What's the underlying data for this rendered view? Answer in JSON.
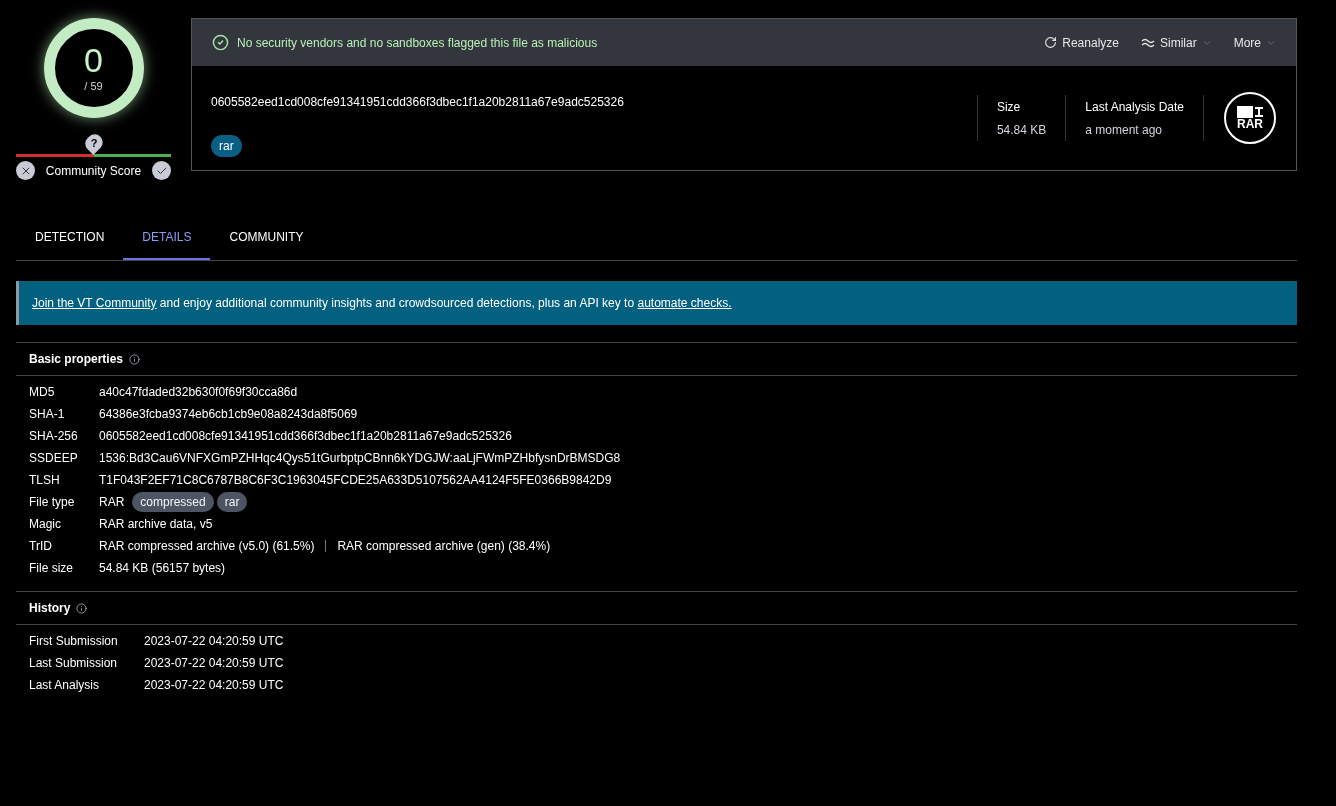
{
  "score": {
    "detections": "0",
    "total": "/ 59"
  },
  "community": {
    "marker": "?",
    "label": "Community Score"
  },
  "banner": {
    "status": "No security vendors and no sandboxes flagged this file as malicious",
    "actions": [
      {
        "label": "Reanalyze",
        "kind": "refresh"
      },
      {
        "label": "Similar",
        "kind": "similar"
      },
      {
        "label": "More",
        "kind": "more"
      }
    ]
  },
  "file": {
    "hash": "0605582eed1cd008cfe91341951cdd366f3dbec1f1a20b2811a67e9adc525326",
    "tags": [
      "rar"
    ],
    "stats": [
      {
        "label": "Size",
        "value": "54.84 KB"
      },
      {
        "label": "Last Analysis Date",
        "value": "a moment ago"
      }
    ],
    "type_icon": "RAR"
  },
  "tabs": [
    {
      "label": "DETECTION",
      "selected": false
    },
    {
      "label": "DETAILS",
      "selected": true
    },
    {
      "label": "COMMUNITY",
      "selected": false
    }
  ],
  "notice": [
    {
      "kind": "link",
      "text": "Join the VT Community"
    },
    {
      "kind": "text",
      "text": " and enjoy additional community insights and crowdsourced detections, plus an API key to "
    },
    {
      "kind": "link",
      "text": "automate checks."
    }
  ],
  "basic_properties": {
    "title": "Basic properties",
    "rows": [
      {
        "label": "MD5",
        "values": [
          "a40c47fdaded32b630f0f69f30cca86d"
        ]
      },
      {
        "label": "SHA-1",
        "values": [
          "64386e3fcba9374eb6cb1cb9e08a8243da8f5069"
        ]
      },
      {
        "label": "SHA-256",
        "values": [
          "0605582eed1cd008cfe91341951cdd366f3dbec1f1a20b2811a67e9adc525326"
        ]
      },
      {
        "label": "SSDEEP",
        "values": [
          "1536:Bd3Cau6VNFXGmPZHHqc4Qys51tGurbptpCBnn6kYDGJW:aaLjFWmPZHbfysnDrBMSDG8"
        ]
      },
      {
        "label": "TLSH",
        "values": [
          "T1F043F2EF71C8C6787B8C6F3C1963045FCDE25A633D5107562AA4124F5FE0366B9842D9"
        ]
      },
      {
        "label": "File type",
        "values": [
          "RAR"
        ],
        "tags": [
          "compressed",
          "rar"
        ]
      },
      {
        "label": "Magic",
        "values": [
          "RAR archive data, v5"
        ]
      },
      {
        "label": "TrID",
        "values": [
          "RAR compressed archive (v5.0) (61.5%)",
          "RAR compressed archive (gen) (38.4%)"
        ]
      },
      {
        "label": "File size",
        "values": [
          "54.84 KB (56157 bytes)"
        ]
      }
    ]
  },
  "history": {
    "title": "History",
    "rows": [
      {
        "label": "First Submission",
        "value": "2023-07-22 04:20:59 UTC"
      },
      {
        "label": "Last Submission",
        "value": "2023-07-22 04:20:59 UTC"
      },
      {
        "label": "Last Analysis",
        "value": "2023-07-22 04:20:59 UTC"
      }
    ]
  }
}
